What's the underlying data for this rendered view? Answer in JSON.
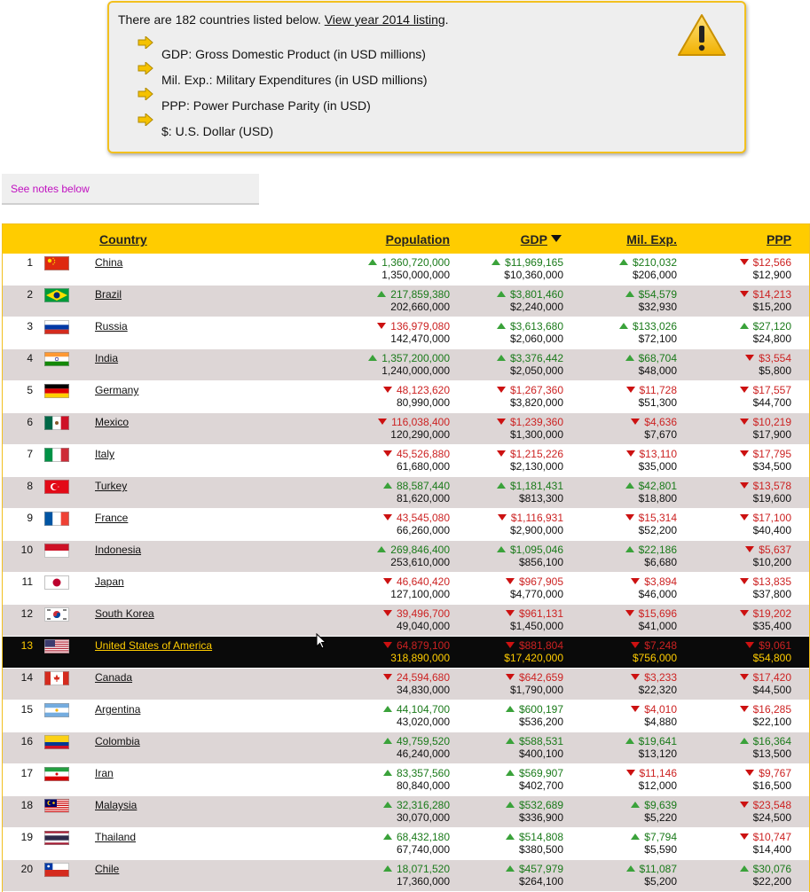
{
  "notice": {
    "intro_text": "There are 182 countries listed below. ",
    "intro_link": "View year 2014 listing",
    "intro_end": ".",
    "items": [
      "GDP: Gross Domestic Product (in USD millions)",
      "Mil. Exp.: Military Expenditures (in USD millions)",
      "PPP: Power Purchase Parity (in USD)",
      "$: U.S. Dollar (USD)"
    ],
    "icon": "warning-icon"
  },
  "notes_link": "See notes below",
  "table": {
    "headers": {
      "country": "Country",
      "population": "Population",
      "gdp": "GDP",
      "mil": "Mil. Exp.",
      "ppp": "PPP"
    },
    "highlight_rank": "13",
    "rows": [
      {
        "rank": "1",
        "country": "China",
        "flag": "cn",
        "pop_dir": "up",
        "pop": "1,360,720,000",
        "pop_prev": "1,350,000,000",
        "gdp_dir": "up",
        "gdp": "$11,969,165",
        "gdp_prev": "$10,360,000",
        "mil_dir": "up",
        "mil": "$210,032",
        "mil_prev": "$206,000",
        "ppp_dir": "down",
        "ppp": "$12,566",
        "ppp_prev": "$12,900"
      },
      {
        "rank": "2",
        "country": "Brazil",
        "flag": "br",
        "pop_dir": "up",
        "pop": "217,859,380",
        "pop_prev": "202,660,000",
        "gdp_dir": "up",
        "gdp": "$3,801,460",
        "gdp_prev": "$2,240,000",
        "mil_dir": "up",
        "mil": "$54,579",
        "mil_prev": "$32,930",
        "ppp_dir": "down",
        "ppp": "$14,213",
        "ppp_prev": "$15,200"
      },
      {
        "rank": "3",
        "country": "Russia",
        "flag": "ru",
        "pop_dir": "down",
        "pop": "136,979,080",
        "pop_prev": "142,470,000",
        "gdp_dir": "up",
        "gdp": "$3,613,680",
        "gdp_prev": "$2,060,000",
        "mil_dir": "up",
        "mil": "$133,026",
        "mil_prev": "$72,100",
        "ppp_dir": "up",
        "ppp": "$27,120",
        "ppp_prev": "$24,800"
      },
      {
        "rank": "4",
        "country": "India",
        "flag": "in",
        "pop_dir": "up",
        "pop": "1,357,200,000",
        "pop_prev": "1,240,000,000",
        "gdp_dir": "up",
        "gdp": "$3,376,442",
        "gdp_prev": "$2,050,000",
        "mil_dir": "up",
        "mil": "$68,704",
        "mil_prev": "$48,000",
        "ppp_dir": "down",
        "ppp": "$3,554",
        "ppp_prev": "$5,800"
      },
      {
        "rank": "5",
        "country": "Germany",
        "flag": "de",
        "pop_dir": "down",
        "pop": "48,123,620",
        "pop_prev": "80,990,000",
        "gdp_dir": "down",
        "gdp": "$1,267,360",
        "gdp_prev": "$3,820,000",
        "mil_dir": "down",
        "mil": "$11,728",
        "mil_prev": "$51,300",
        "ppp_dir": "down",
        "ppp": "$17,557",
        "ppp_prev": "$44,700"
      },
      {
        "rank": "6",
        "country": "Mexico",
        "flag": "mx",
        "pop_dir": "down",
        "pop": "116,038,400",
        "pop_prev": "120,290,000",
        "gdp_dir": "down",
        "gdp": "$1,239,360",
        "gdp_prev": "$1,300,000",
        "mil_dir": "down",
        "mil": "$4,636",
        "mil_prev": "$7,670",
        "ppp_dir": "down",
        "ppp": "$10,219",
        "ppp_prev": "$17,900"
      },
      {
        "rank": "7",
        "country": "Italy",
        "flag": "it",
        "pop_dir": "down",
        "pop": "45,526,880",
        "pop_prev": "61,680,000",
        "gdp_dir": "down",
        "gdp": "$1,215,226",
        "gdp_prev": "$2,130,000",
        "mil_dir": "down",
        "mil": "$13,110",
        "mil_prev": "$35,000",
        "ppp_dir": "down",
        "ppp": "$17,795",
        "ppp_prev": "$34,500"
      },
      {
        "rank": "8",
        "country": "Turkey",
        "flag": "tr",
        "pop_dir": "up",
        "pop": "88,587,440",
        "pop_prev": "81,620,000",
        "gdp_dir": "up",
        "gdp": "$1,181,431",
        "gdp_prev": "$813,300",
        "mil_dir": "up",
        "mil": "$42,801",
        "mil_prev": "$18,800",
        "ppp_dir": "down",
        "ppp": "$13,578",
        "ppp_prev": "$19,600"
      },
      {
        "rank": "9",
        "country": "France",
        "flag": "fr",
        "pop_dir": "down",
        "pop": "43,545,080",
        "pop_prev": "66,260,000",
        "gdp_dir": "down",
        "gdp": "$1,116,931",
        "gdp_prev": "$2,900,000",
        "mil_dir": "down",
        "mil": "$15,314",
        "mil_prev": "$52,200",
        "ppp_dir": "down",
        "ppp": "$17,100",
        "ppp_prev": "$40,400"
      },
      {
        "rank": "10",
        "country": "Indonesia",
        "flag": "id",
        "pop_dir": "up",
        "pop": "269,846,400",
        "pop_prev": "253,610,000",
        "gdp_dir": "up",
        "gdp": "$1,095,046",
        "gdp_prev": "$856,100",
        "mil_dir": "up",
        "mil": "$22,186",
        "mil_prev": "$6,680",
        "ppp_dir": "down",
        "ppp": "$5,637",
        "ppp_prev": "$10,200"
      },
      {
        "rank": "11",
        "country": "Japan",
        "flag": "jp",
        "pop_dir": "down",
        "pop": "46,640,420",
        "pop_prev": "127,100,000",
        "gdp_dir": "down",
        "gdp": "$967,905",
        "gdp_prev": "$4,770,000",
        "mil_dir": "down",
        "mil": "$3,894",
        "mil_prev": "$46,000",
        "ppp_dir": "down",
        "ppp": "$13,835",
        "ppp_prev": "$37,800"
      },
      {
        "rank": "12",
        "country": "South Korea",
        "flag": "kr",
        "pop_dir": "down",
        "pop": "39,496,700",
        "pop_prev": "49,040,000",
        "gdp_dir": "down",
        "gdp": "$961,131",
        "gdp_prev": "$1,450,000",
        "mil_dir": "down",
        "mil": "$15,696",
        "mil_prev": "$41,000",
        "ppp_dir": "down",
        "ppp": "$19,202",
        "ppp_prev": "$35,400"
      },
      {
        "rank": "13",
        "country": "United States of America",
        "flag": "us",
        "pop_dir": "down",
        "pop": "64,879,100",
        "pop_prev": "318,890,000",
        "gdp_dir": "down",
        "gdp": "$881,804",
        "gdp_prev": "$17,420,000",
        "mil_dir": "down",
        "mil": "$7,248",
        "mil_prev": "$756,000",
        "ppp_dir": "down",
        "ppp": "$9,061",
        "ppp_prev": "$54,800"
      },
      {
        "rank": "14",
        "country": "Canada",
        "flag": "ca",
        "pop_dir": "down",
        "pop": "24,594,680",
        "pop_prev": "34,830,000",
        "gdp_dir": "down",
        "gdp": "$642,659",
        "gdp_prev": "$1,790,000",
        "mil_dir": "down",
        "mil": "$3,233",
        "mil_prev": "$22,320",
        "ppp_dir": "down",
        "ppp": "$17,420",
        "ppp_prev": "$44,500"
      },
      {
        "rank": "15",
        "country": "Argentina",
        "flag": "ar",
        "pop_dir": "up",
        "pop": "44,104,700",
        "pop_prev": "43,020,000",
        "gdp_dir": "up",
        "gdp": "$600,197",
        "gdp_prev": "$536,200",
        "mil_dir": "down",
        "mil": "$4,010",
        "mil_prev": "$4,880",
        "ppp_dir": "down",
        "ppp": "$16,285",
        "ppp_prev": "$22,100"
      },
      {
        "rank": "16",
        "country": "Colombia",
        "flag": "co",
        "pop_dir": "up",
        "pop": "49,759,520",
        "pop_prev": "46,240,000",
        "gdp_dir": "up",
        "gdp": "$588,531",
        "gdp_prev": "$400,100",
        "mil_dir": "up",
        "mil": "$19,641",
        "mil_prev": "$13,120",
        "ppp_dir": "up",
        "ppp": "$16,364",
        "ppp_prev": "$13,500"
      },
      {
        "rank": "17",
        "country": "Iran",
        "flag": "ir",
        "pop_dir": "up",
        "pop": "83,357,560",
        "pop_prev": "80,840,000",
        "gdp_dir": "up",
        "gdp": "$569,907",
        "gdp_prev": "$402,700",
        "mil_dir": "down",
        "mil": "$11,146",
        "mil_prev": "$12,000",
        "ppp_dir": "down",
        "ppp": "$9,767",
        "ppp_prev": "$16,500"
      },
      {
        "rank": "18",
        "country": "Malaysia",
        "flag": "my",
        "pop_dir": "up",
        "pop": "32,316,280",
        "pop_prev": "30,070,000",
        "gdp_dir": "up",
        "gdp": "$532,689",
        "gdp_prev": "$336,900",
        "mil_dir": "up",
        "mil": "$9,639",
        "mil_prev": "$5,220",
        "ppp_dir": "down",
        "ppp": "$23,548",
        "ppp_prev": "$24,500"
      },
      {
        "rank": "19",
        "country": "Thailand",
        "flag": "th",
        "pop_dir": "up",
        "pop": "68,432,180",
        "pop_prev": "67,740,000",
        "gdp_dir": "up",
        "gdp": "$514,808",
        "gdp_prev": "$380,500",
        "mil_dir": "up",
        "mil": "$7,794",
        "mil_prev": "$5,590",
        "ppp_dir": "down",
        "ppp": "$10,747",
        "ppp_prev": "$14,400"
      },
      {
        "rank": "20",
        "country": "Chile",
        "flag": "cl",
        "pop_dir": "up",
        "pop": "18,071,520",
        "pop_prev": "17,360,000",
        "gdp_dir": "up",
        "gdp": "$457,979",
        "gdp_prev": "$264,100",
        "mil_dir": "up",
        "mil": "$11,087",
        "mil_prev": "$5,200",
        "ppp_dir": "up",
        "ppp": "$30,076",
        "ppp_prev": "$22,200"
      }
    ]
  }
}
